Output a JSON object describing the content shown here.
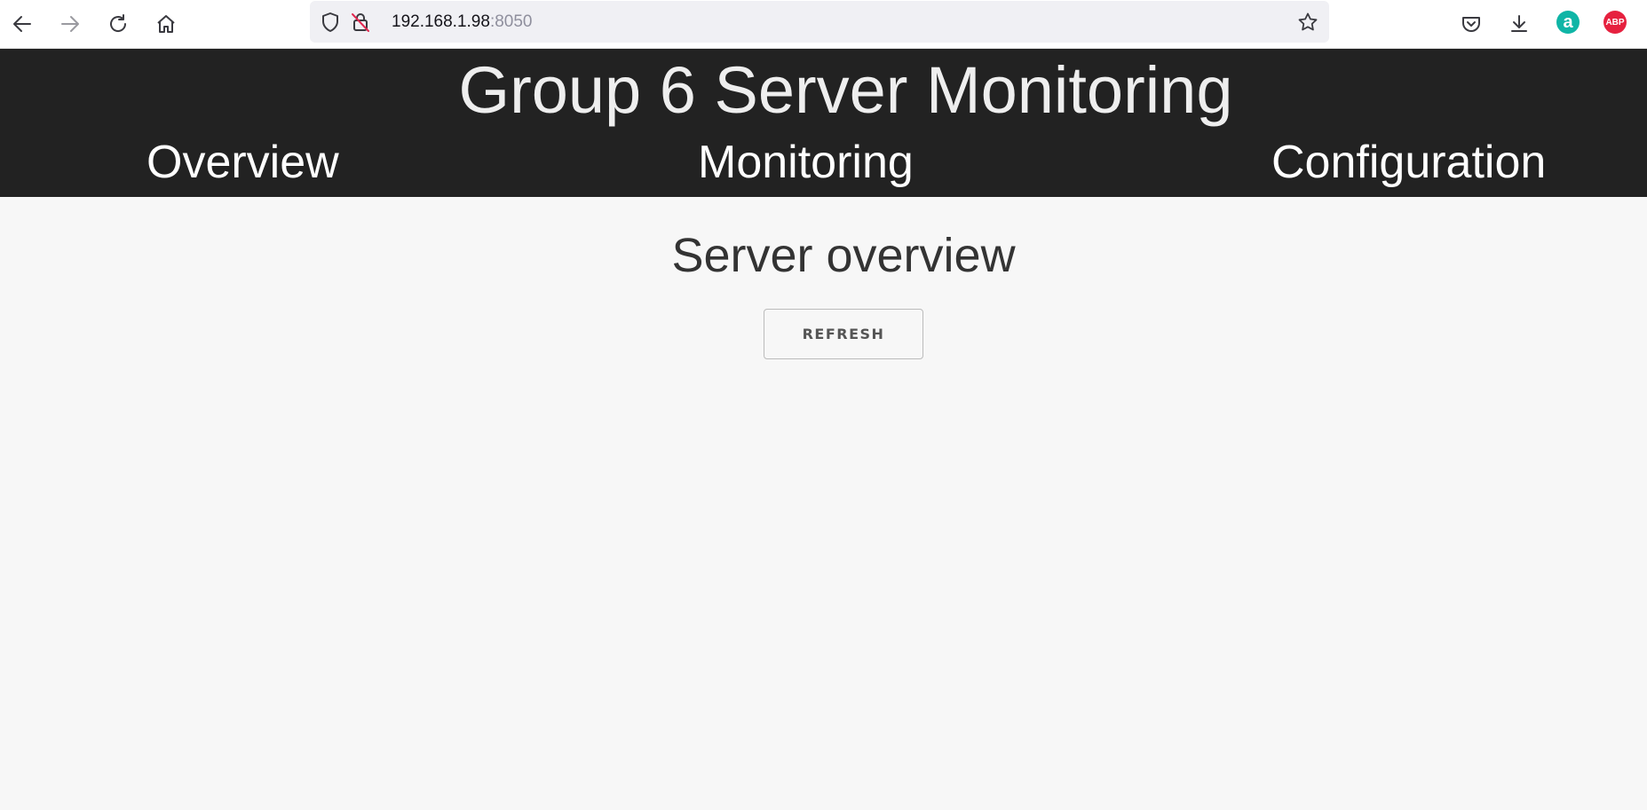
{
  "browser": {
    "url_host": "192.168.1.98",
    "url_port": ":8050",
    "icons": {
      "back": "back-arrow-icon",
      "forward": "forward-arrow-icon",
      "reload": "reload-icon",
      "home": "home-icon",
      "tracking": "shield-icon",
      "insecure": "insecure-lock-icon",
      "bookmark": "star-icon",
      "pocket": "pocket-icon",
      "downloads": "download-icon",
      "ext_a": "extension-a-icon",
      "adblock": "adblock-plus-icon"
    },
    "ext_a_label": "a",
    "adblock_label": "ABP",
    "colors": {
      "ext_a": "#0fb5a6",
      "adblock": "#e6213f"
    }
  },
  "site": {
    "title": "Group 6 Server Monitoring",
    "nav": {
      "overview": "Overview",
      "monitoring": "Monitoring",
      "configuration": "Configuration"
    },
    "colors": {
      "header_bg": "#222222",
      "page_bg": "#f7f7f7"
    }
  },
  "main": {
    "title": "Server overview",
    "refresh_label": "REFRESH"
  }
}
